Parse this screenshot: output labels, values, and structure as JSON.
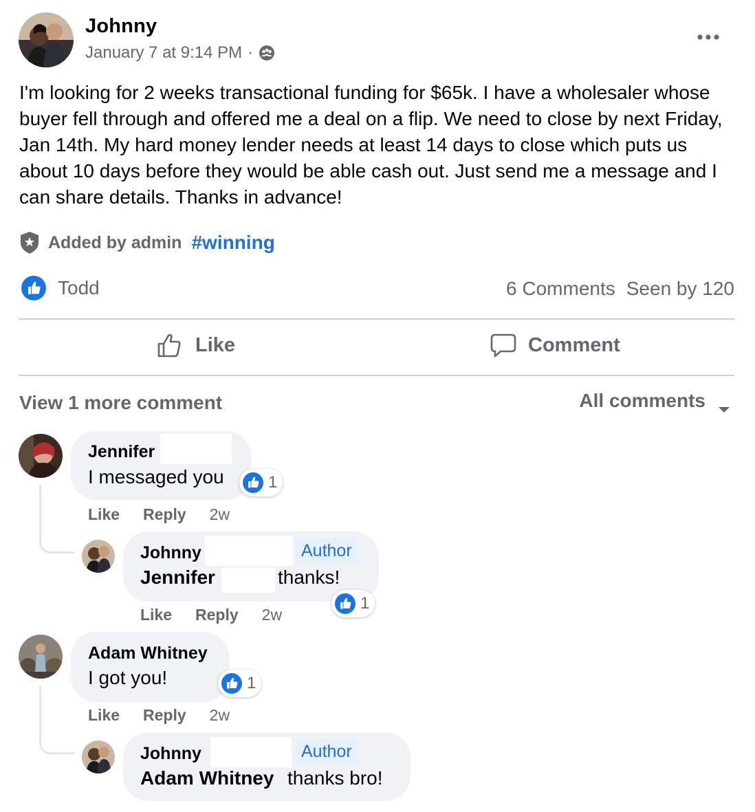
{
  "post": {
    "author": "Johnny",
    "timestamp": "January 7 at 9:14 PM",
    "separator": "·",
    "audience_icon": "group-globe-icon",
    "body": "I'm looking for 2 weeks transactional funding for $65k. I have a wholesaler whose buyer fell through and offered me a deal on a flip. We need to close by next Friday, Jan 14th. My hard money lender needs at least 14 days to close which puts us about 10 days before they would be able cash out. Just send me a message and I can share details. Thanks in advance!",
    "added_by": "Added by admin",
    "hashtag": "#winning",
    "reactor": "Todd",
    "comments_count": "6 Comments",
    "seen_by": "Seen by 120"
  },
  "actions": {
    "like": "Like",
    "comment": "Comment"
  },
  "comments_header": {
    "view_more": "View 1 more comment",
    "filter": "All comments"
  },
  "comments": [
    {
      "name": "Jennifer",
      "text": "I messaged you",
      "reactions": "1",
      "like": "Like",
      "reply": "Reply",
      "time": "2w",
      "reply_item": {
        "name": "Johnny",
        "badge": "Author",
        "mention": "Jennifer",
        "text": "thanks!",
        "reactions": "1",
        "like": "Like",
        "reply": "Reply",
        "time": "2w"
      }
    },
    {
      "name": "Adam Whitney",
      "text": "I got you!",
      "reactions": "1",
      "like": "Like",
      "reply": "Reply",
      "time": "2w",
      "reply_item": {
        "name": "Johnny",
        "badge": "Author",
        "mention": "Adam Whitney",
        "text": "thanks bro!"
      }
    }
  ],
  "colors": {
    "accent_blue": "#216fdb",
    "muted_text": "#65676b",
    "bubble_bg": "#f0f2f5",
    "author_badge_bg": "#e7f0fd"
  }
}
